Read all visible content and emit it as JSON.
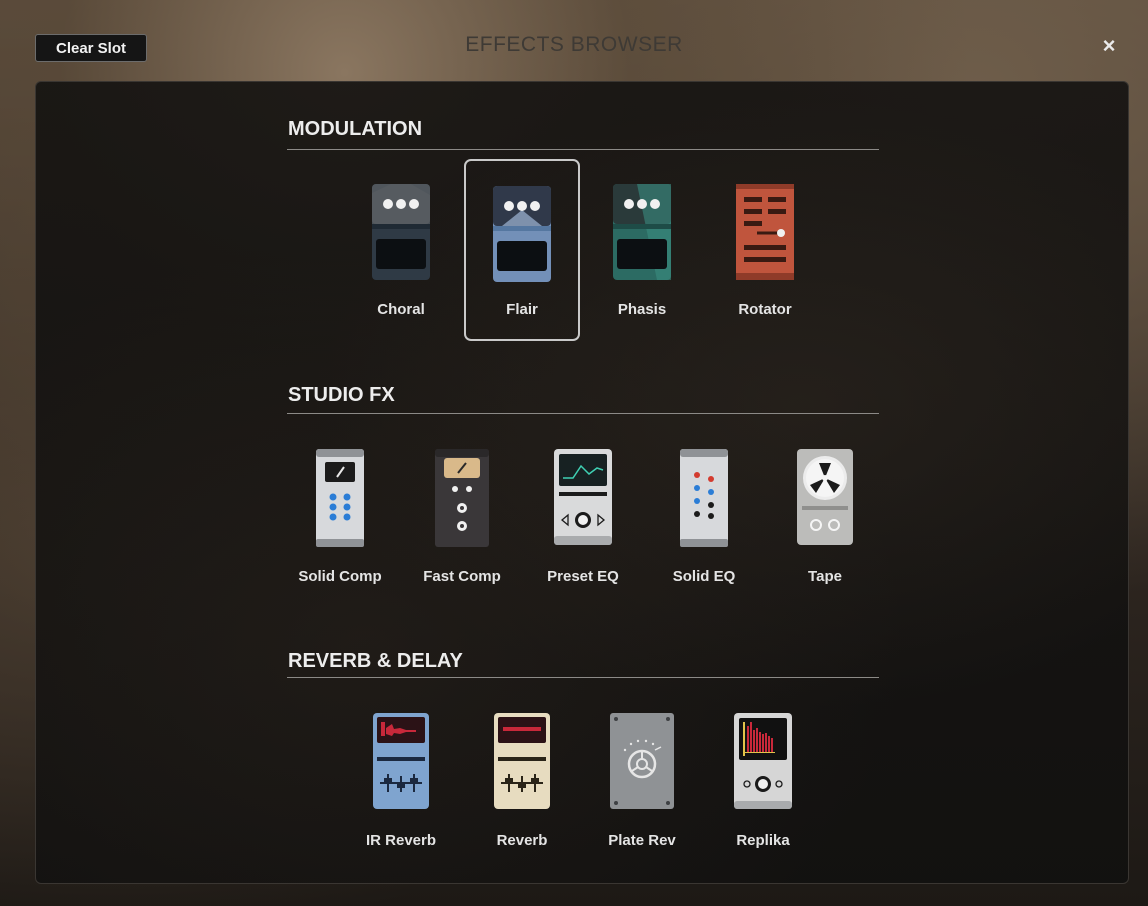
{
  "header": {
    "clear_slot_label": "Clear Slot",
    "title": "EFFECTS BROWSER",
    "close_glyph": "×"
  },
  "sections": [
    {
      "title": "MODULATION",
      "items": [
        {
          "label": "Choral",
          "icon": "choral-pedal-icon",
          "selected": false
        },
        {
          "label": "Flair",
          "icon": "flair-pedal-icon",
          "selected": true
        },
        {
          "label": "Phasis",
          "icon": "phasis-pedal-icon",
          "selected": false
        },
        {
          "label": "Rotator",
          "icon": "rotator-pedal-icon",
          "selected": false
        }
      ]
    },
    {
      "title": "STUDIO FX",
      "items": [
        {
          "label": "Solid Comp",
          "icon": "solid-comp-icon",
          "selected": false
        },
        {
          "label": "Fast Comp",
          "icon": "fast-comp-icon",
          "selected": false
        },
        {
          "label": "Preset EQ",
          "icon": "preset-eq-icon",
          "selected": false
        },
        {
          "label": "Solid EQ",
          "icon": "solid-eq-icon",
          "selected": false
        },
        {
          "label": "Tape",
          "icon": "tape-icon",
          "selected": false
        }
      ]
    },
    {
      "title": "REVERB & DELAY",
      "items": [
        {
          "label": "IR Reverb",
          "icon": "ir-reverb-icon",
          "selected": false
        },
        {
          "label": "Reverb",
          "icon": "reverb-icon",
          "selected": false
        },
        {
          "label": "Plate Rev",
          "icon": "plate-reverb-icon",
          "selected": false
        },
        {
          "label": "Replika",
          "icon": "replika-delay-icon",
          "selected": false
        }
      ]
    }
  ]
}
